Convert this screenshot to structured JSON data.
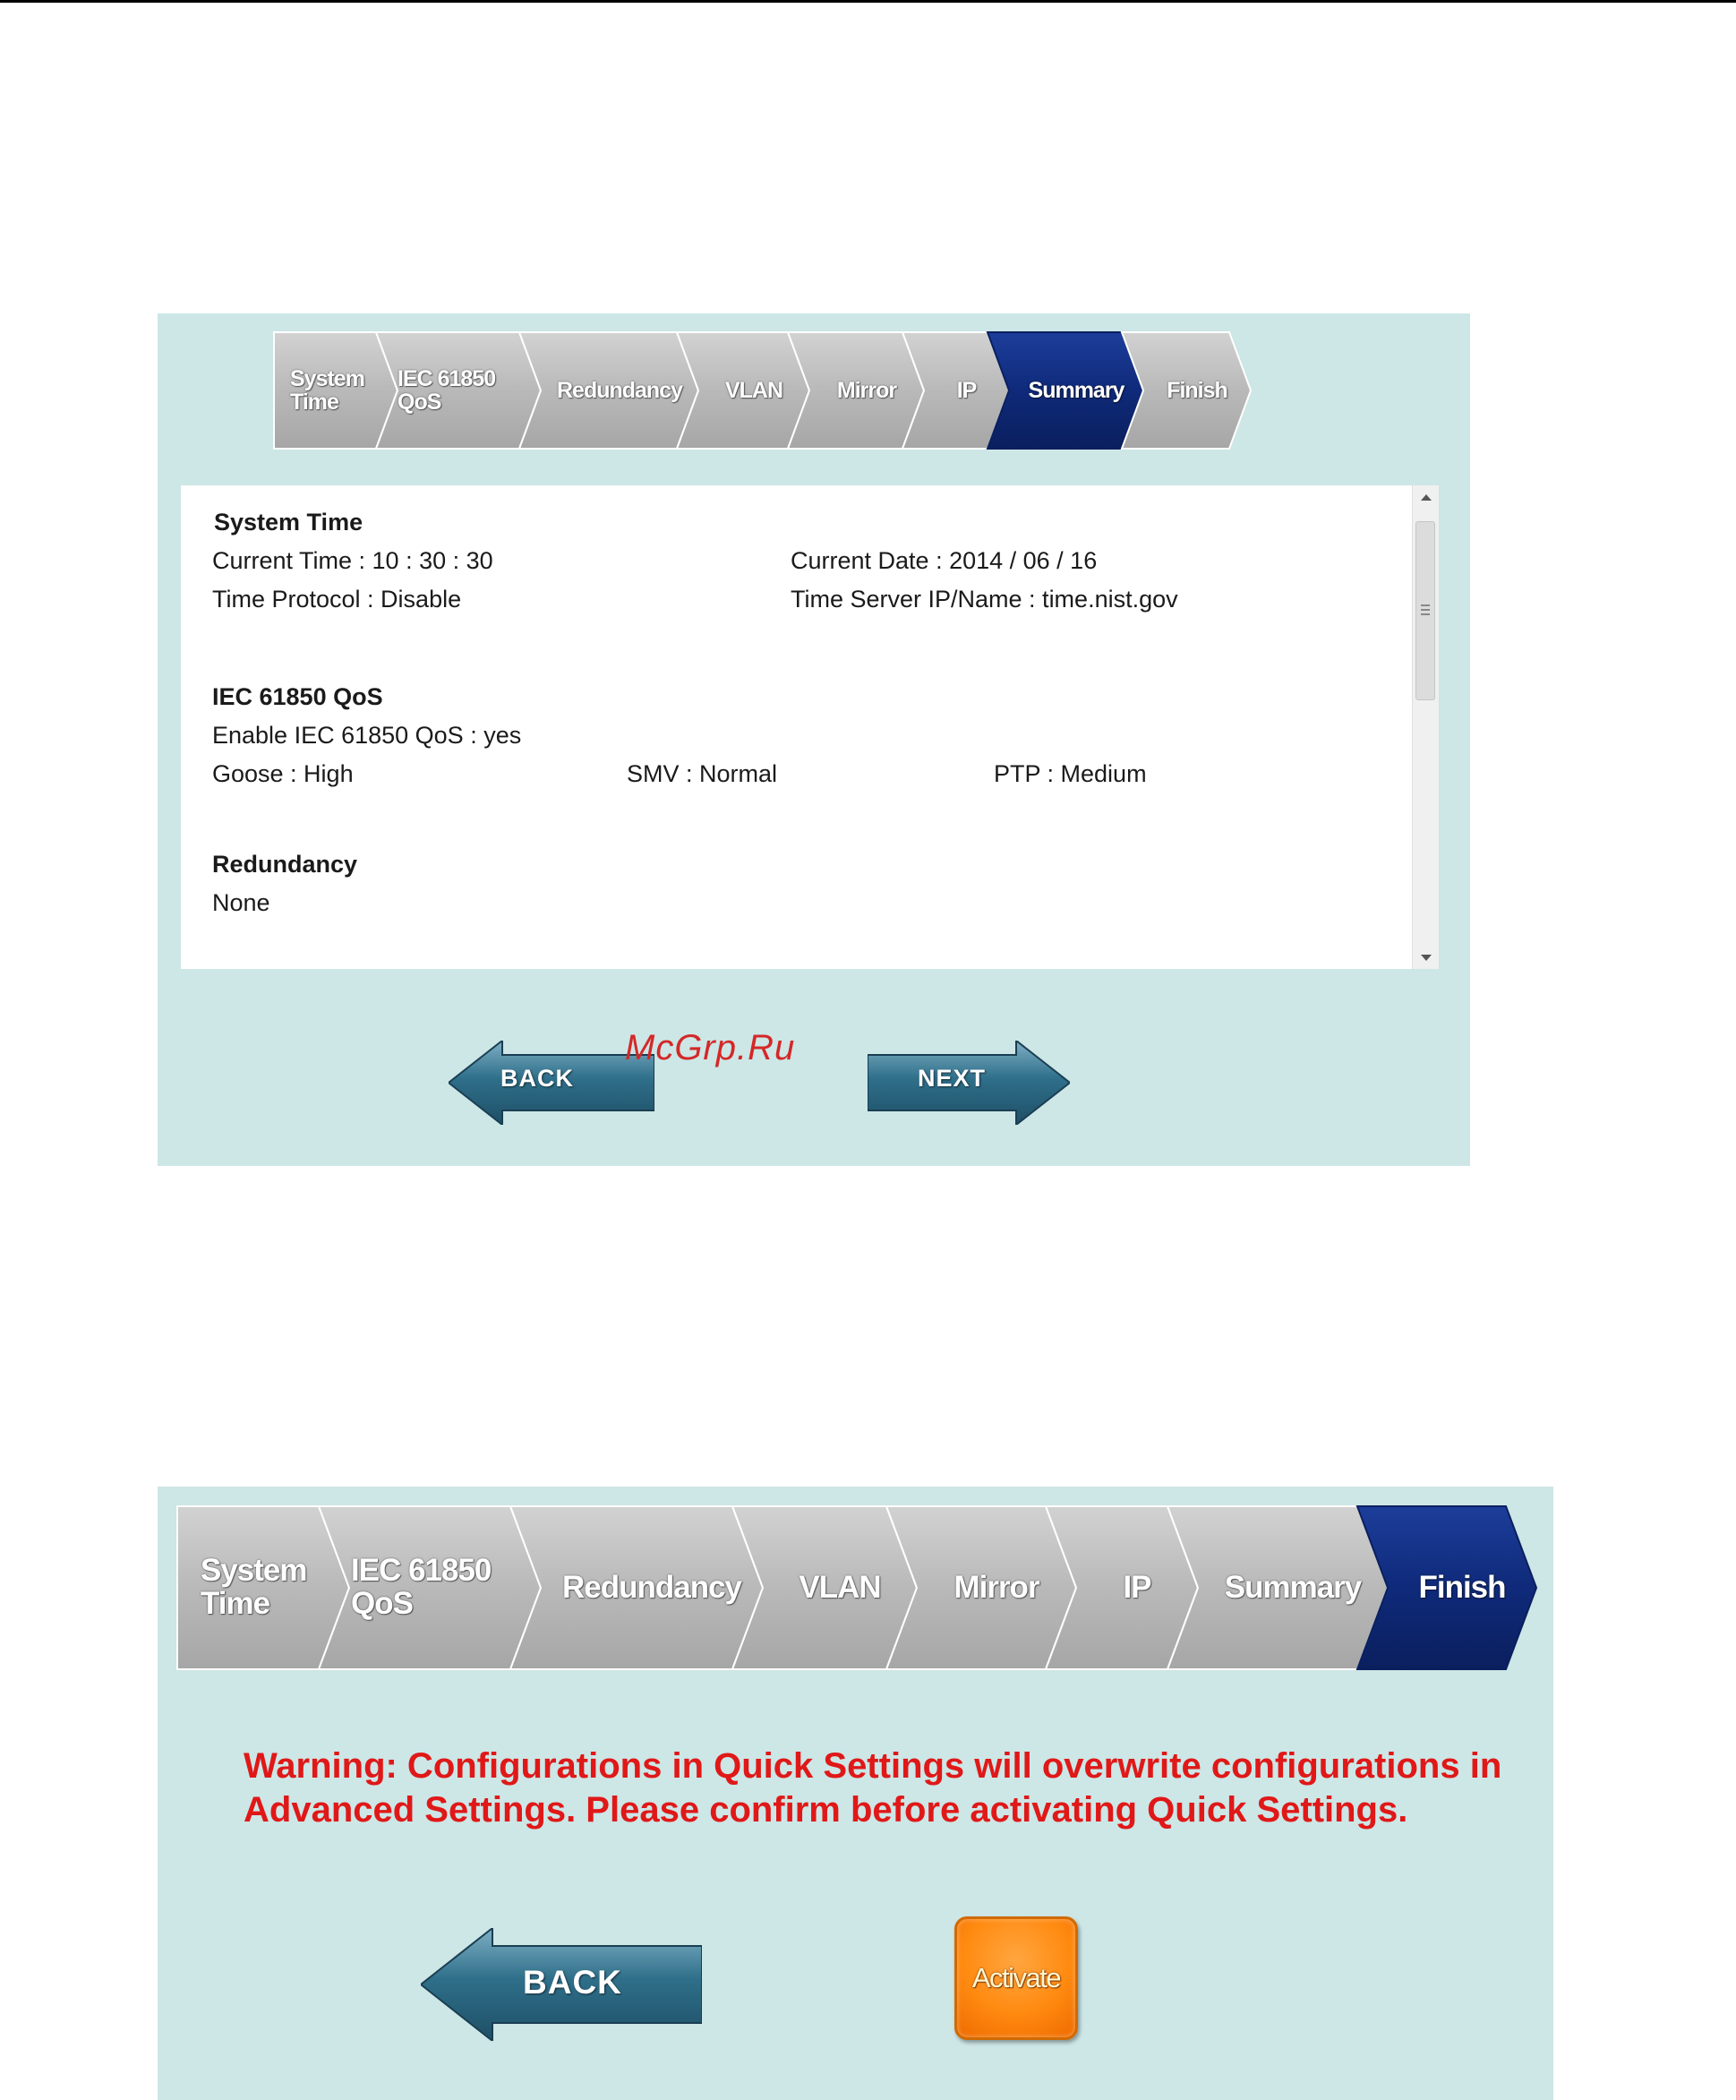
{
  "panel_summary": {
    "steps": [
      {
        "lines": [
          "System",
          "Time"
        ],
        "active": false
      },
      {
        "lines": [
          "IEC 61850",
          "QoS"
        ],
        "active": false
      },
      {
        "lines": [
          "Redundancy"
        ],
        "active": false
      },
      {
        "lines": [
          "VLAN"
        ],
        "active": false
      },
      {
        "lines": [
          "Mirror"
        ],
        "active": false
      },
      {
        "lines": [
          "IP"
        ],
        "active": false
      },
      {
        "lines": [
          "Summary"
        ],
        "active": true
      },
      {
        "lines": [
          "Finish"
        ],
        "active": false
      }
    ],
    "summary": {
      "system_time": {
        "heading": "System Time",
        "current_time": "Current Time : 10 : 30 : 30",
        "current_date": "Current Date : 2014 / 06 / 16",
        "time_protocol": "Time Protocol : Disable",
        "time_server": "Time Server IP/Name : time.nist.gov"
      },
      "iec_qos": {
        "heading": "IEC 61850 QoS",
        "enable": "Enable IEC 61850 QoS : yes",
        "goose": "Goose : High",
        "smv": "SMV : Normal",
        "ptp": "PTP : Medium"
      },
      "redundancy": {
        "heading": "Redundancy",
        "value": "None"
      }
    },
    "back_label": "BACK",
    "next_label": "NEXT"
  },
  "watermark": "McGrp.Ru",
  "panel_finish": {
    "steps": [
      {
        "lines": [
          "System",
          "Time"
        ],
        "active": false
      },
      {
        "lines": [
          "IEC 61850",
          "QoS"
        ],
        "active": false
      },
      {
        "lines": [
          "Redundancy"
        ],
        "active": false
      },
      {
        "lines": [
          "VLAN"
        ],
        "active": false
      },
      {
        "lines": [
          "Mirror"
        ],
        "active": false
      },
      {
        "lines": [
          "IP"
        ],
        "active": false
      },
      {
        "lines": [
          "Summary"
        ],
        "active": false
      },
      {
        "lines": [
          "Finish"
        ],
        "active": true
      }
    ],
    "warning": "Warning: Configurations in Quick Settings will overwrite configurations in Advanced Settings. Please confirm before activating Quick Settings.",
    "back_label": "BACK",
    "activate_label": "Activate"
  },
  "colors": {
    "panel_bg": "#cde6e6",
    "step_inactive": "#b9b9b9",
    "step_active": "#0f2a7a",
    "warning_text": "#e01818",
    "activate_orange": "#ff8a10",
    "arrow_button": "#2f6f8a"
  }
}
